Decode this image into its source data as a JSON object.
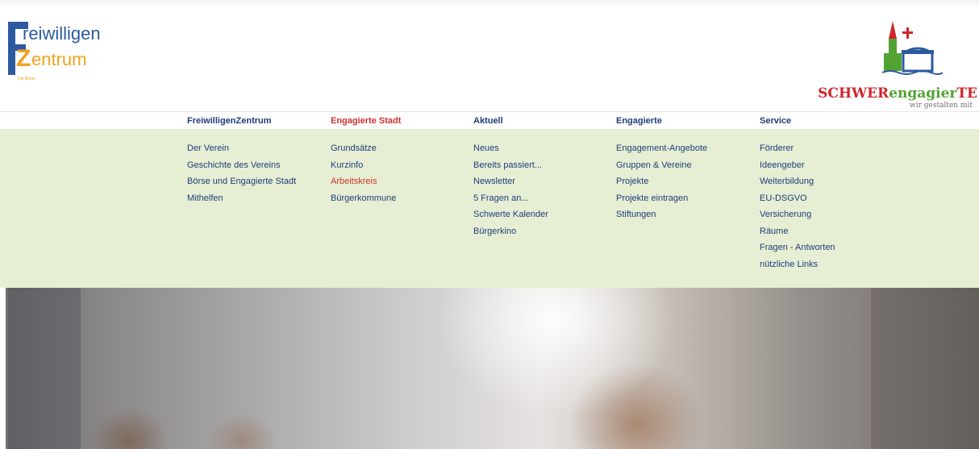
{
  "brand_left": {
    "line1": "reiwilligen",
    "line2": "entrum",
    "tagline": "Die Börse"
  },
  "brand_right": {
    "word_red": "SCHWER",
    "word_green": "engagier",
    "word_red2": "TE",
    "subtitle": "wir gestalten mit"
  },
  "menu": [
    {
      "title": "FreiwilligenZentrum",
      "items": [
        "Der Verein",
        "Geschichte des Vereins",
        "Börse und Engagierte Stadt",
        "Mithelfen"
      ]
    },
    {
      "title": "Engagierte Stadt",
      "items": [
        "Grundsätze",
        "Kurzinfo",
        "Arbeitskreis",
        "Bürgerkommune"
      ]
    },
    {
      "title": "Aktuell",
      "items": [
        "Neues",
        "Bereits passiert...",
        "Newsletter",
        "5 Fragen an...",
        "Schwerte Kalender",
        "Bürgerkino"
      ]
    },
    {
      "title": "Engagierte",
      "items": [
        "Engagement-Angebote",
        "Gruppen & Vereine",
        "Projekte",
        "Projekte eintragen",
        "Stiftungen"
      ]
    },
    {
      "title": "Service",
      "items": [
        "Förderer",
        "Ideengeber",
        "Weiterbildung",
        "EU-DSGVO",
        "Versicherung",
        "Räume",
        "Fragen - Antworten",
        "nützliche Links"
      ]
    }
  ],
  "colors": {
    "nav_text": "#1f3d7a",
    "active": "#d0312d",
    "menu_bg": "#e6efd4",
    "brand_blue": "#2c5aa0",
    "brand_orange": "#f0a21c"
  },
  "hero": {
    "image": "blurred-street-photo"
  }
}
